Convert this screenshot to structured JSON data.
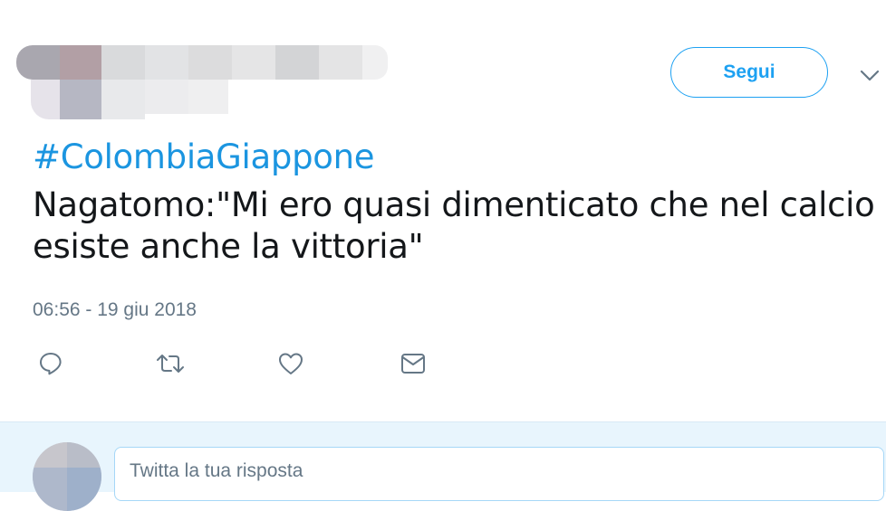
{
  "tweet": {
    "hashtag": "#ColombiaGiappone",
    "text": "Nagatomo:\"Mi ero quasi dimenticato che nel calcio esiste anche la vittoria\"",
    "timestamp": "06:56 - 19 giu 2018"
  },
  "header": {
    "follow_label": "Segui"
  },
  "reply": {
    "placeholder": "Twitta la tua risposta"
  },
  "icons": {
    "reply": "reply-icon",
    "retweet": "retweet-icon",
    "like": "heart-icon",
    "message": "envelope-icon",
    "caret": "chevron-down-icon"
  },
  "colors": {
    "accent": "#1da1f2",
    "hashtag": "#1b95e0",
    "muted": "#657786",
    "text": "#14171a",
    "reply_bg": "#e8f5fd"
  }
}
